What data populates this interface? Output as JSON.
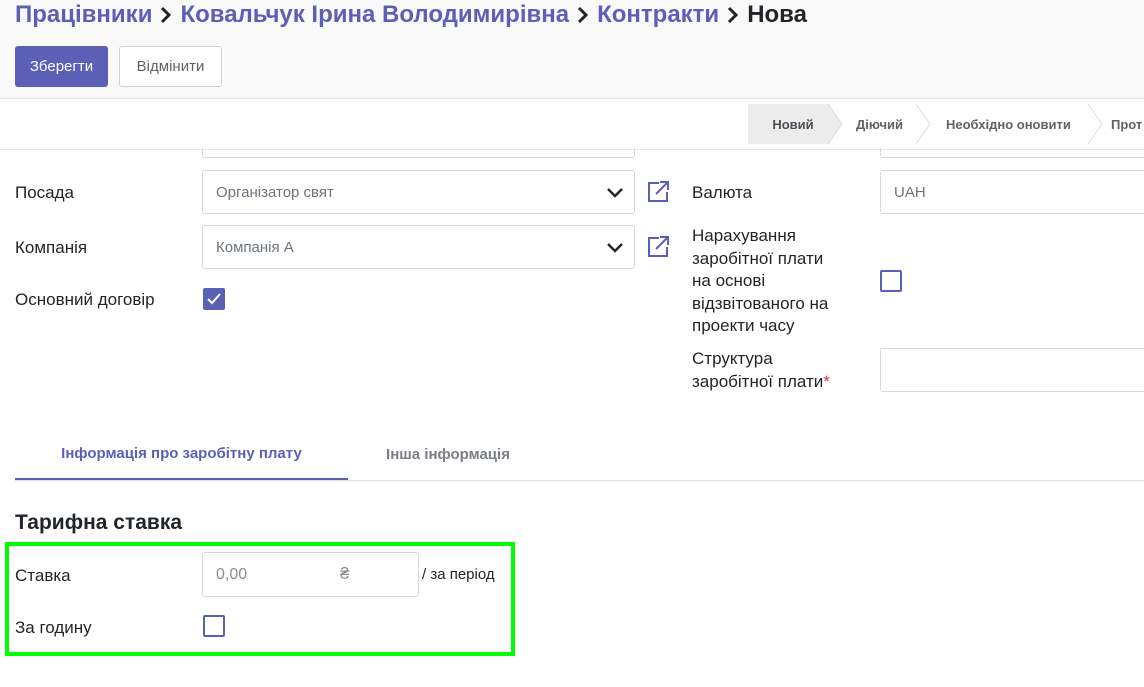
{
  "breadcrumb": {
    "items": [
      "Працівники",
      "Ковальчук Ірина Володимирівна",
      "Контракти"
    ],
    "current": "Нова"
  },
  "actions": {
    "save_label": "Зберегти",
    "discard_label": "Відмінити"
  },
  "statusbar": {
    "stages": [
      "Новий",
      "Діючий",
      "Необхідно оновити",
      "Прот"
    ],
    "active": "Новий"
  },
  "form": {
    "left": {
      "position": {
        "label": "Посада",
        "value": "Організатор свят"
      },
      "company": {
        "label": "Компанія",
        "value": "Компанія A"
      },
      "main_contract": {
        "label": "Основний договір",
        "checked": true
      }
    },
    "right": {
      "currency": {
        "label": "Валюта",
        "value": "UAH"
      },
      "timesheet_payroll": {
        "label_lines": [
          "Нарахування",
          "заробітної плати",
          "на основі",
          "відзвітованого на",
          "проекти часу"
        ],
        "checked": false
      },
      "salary_structure": {
        "label_lines": [
          "Структура",
          "заробітної плати"
        ],
        "required_mark": "*",
        "value": ""
      }
    }
  },
  "tabs": [
    {
      "label": "Інформація про заробітну плату",
      "active": true
    },
    {
      "label": "Інша інформація",
      "active": false
    }
  ],
  "wage": {
    "section_title": "Тарифна ставка",
    "rate_label": "Ставка",
    "rate_value": "0,00",
    "currency_symbol": "₴",
    "period_text": "/ за період",
    "hourly_label": "За годину",
    "hourly_checked": false
  },
  "colors": {
    "accent": "#5b5fb5",
    "highlight": "#00ff00",
    "required": "#dc3545"
  }
}
